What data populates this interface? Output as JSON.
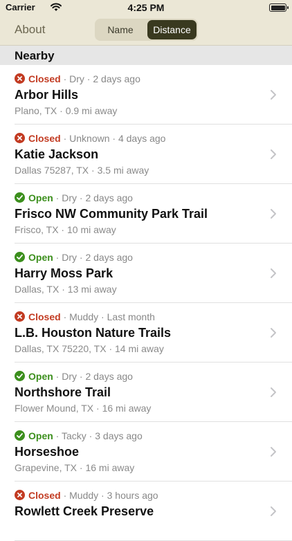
{
  "status_bar": {
    "carrier": "Carrier",
    "time": "4:25 PM"
  },
  "nav": {
    "about_label": "About",
    "segments": [
      "Name",
      "Distance"
    ],
    "selected_segment": "Distance"
  },
  "section_title": "Nearby",
  "colors": {
    "closed": "#c23b22",
    "open": "#3c8f1d",
    "accent": "#39391f"
  },
  "trails": [
    {
      "status": "Closed",
      "condition": "Dry",
      "updated": "2 days ago",
      "name": "Arbor Hills",
      "location": "Plano, TX",
      "distance": "0.9 mi away"
    },
    {
      "status": "Closed",
      "condition": "Unknown",
      "updated": "4 days ago",
      "name": "Katie Jackson",
      "location": "Dallas 75287, TX",
      "distance": "3.5 mi away"
    },
    {
      "status": "Open",
      "condition": "Dry",
      "updated": "2 days ago",
      "name": "Frisco NW Community Park Trail",
      "location": "Frisco, TX",
      "distance": "10 mi away"
    },
    {
      "status": "Open",
      "condition": "Dry",
      "updated": "2 days ago",
      "name": "Harry Moss Park",
      "location": "Dallas, TX",
      "distance": "13 mi away"
    },
    {
      "status": "Closed",
      "condition": "Muddy",
      "updated": "Last month",
      "name": "L.B. Houston Nature Trails",
      "location": "Dallas, TX  75220, TX",
      "distance": "14 mi away"
    },
    {
      "status": "Open",
      "condition": "Dry",
      "updated": "2 days ago",
      "name": "Northshore Trail",
      "location": "Flower Mound, TX",
      "distance": "16 mi away"
    },
    {
      "status": "Open",
      "condition": "Tacky",
      "updated": "3 days ago",
      "name": "Horseshoe",
      "location": "Grapevine, TX",
      "distance": "16 mi away"
    },
    {
      "status": "Closed",
      "condition": "Muddy",
      "updated": "3 hours ago",
      "name": "Rowlett Creek Preserve",
      "location": "",
      "distance": ""
    }
  ]
}
